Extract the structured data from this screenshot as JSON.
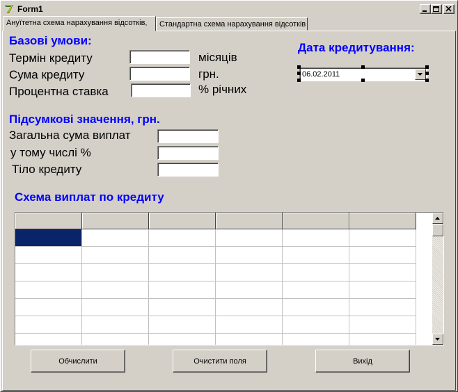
{
  "window": {
    "title": "Form1"
  },
  "tabs": [
    {
      "label": "Ануїтетна схема нарахування відсотків,"
    },
    {
      "label": "Стандартна схема нарахування відсотків"
    }
  ],
  "base_conditions": {
    "header": "Базові умови:",
    "term_label": "Термін кредиту",
    "term_value": "",
    "term_unit": "місяців",
    "amount_label": "Сума кредиту",
    "amount_value": "",
    "amount_unit": "грн.",
    "rate_label": "Процентна ставка",
    "rate_value": "",
    "rate_unit": "% річних"
  },
  "credit_date": {
    "header": "Дата кредитування:",
    "value": "06.02.2011"
  },
  "totals": {
    "header": "Підсумкові значення, грн.",
    "total_label": "Загальна сума виплат",
    "total_value": "",
    "interest_label": "у тому числі %",
    "interest_value": "",
    "principal_label": "Тіло кредиту",
    "principal_value": ""
  },
  "schedule": {
    "header": "Схема виплат по кредиту",
    "columns": 6,
    "rows": 8
  },
  "buttons": {
    "calculate": "Обчислити",
    "clear": "Очистити поля",
    "exit": "Вихід"
  }
}
